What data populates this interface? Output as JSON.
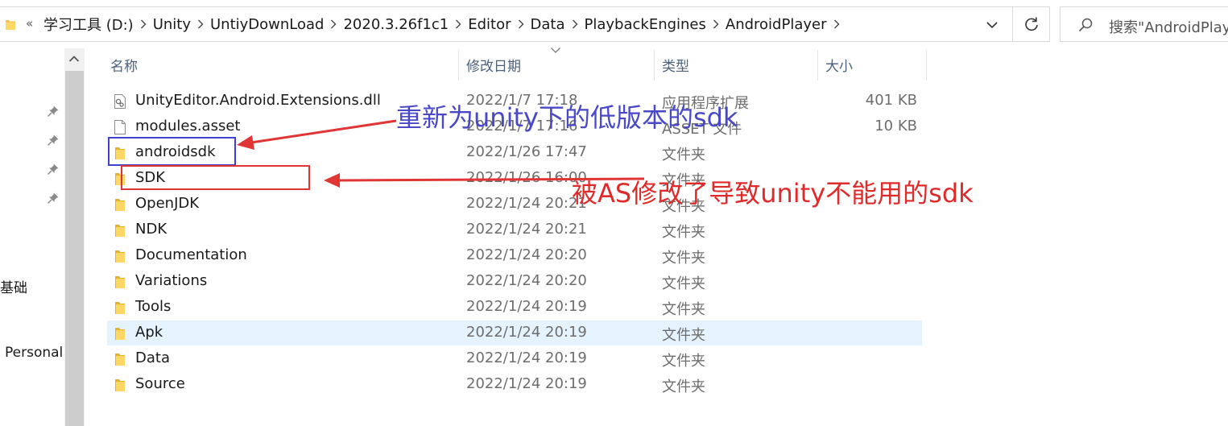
{
  "address_bar": {
    "overflow": "«",
    "path": [
      "学习工具 (D:)",
      "Unity",
      "UntiyDownLoad",
      "2020.3.26f1c1",
      "Editor",
      "Data",
      "PlaybackEngines",
      "AndroidPlayer"
    ]
  },
  "search": {
    "placeholder": "搜索\"AndroidPlayer\""
  },
  "nav_pane": {
    "items": [
      "基础",
      "Personal"
    ]
  },
  "columns": {
    "name": "名称",
    "date": "修改日期",
    "type": "类型",
    "size": "大小"
  },
  "files": [
    {
      "name": "UnityEditor.Android.Extensions.dll",
      "date": "2022/1/7 17:18",
      "type": "应用程序扩展",
      "size": "401 KB",
      "icon": "dll-file-icon"
    },
    {
      "name": "modules.asset",
      "date": "2022/1/7 17:16",
      "type": "ASSET 文件",
      "size": "10 KB",
      "icon": "file-icon"
    },
    {
      "name": "androidsdk",
      "date": "2022/1/26 17:47",
      "type": "文件夹",
      "size": "",
      "icon": "folder-icon"
    },
    {
      "name": "SDK",
      "date": "2022/1/26 16:00",
      "type": "文件夹",
      "size": "",
      "icon": "folder-icon"
    },
    {
      "name": "OpenJDK",
      "date": "2022/1/24 20:21",
      "type": "文件夹",
      "size": "",
      "icon": "folder-icon"
    },
    {
      "name": "NDK",
      "date": "2022/1/24 20:21",
      "type": "文件夹",
      "size": "",
      "icon": "folder-icon"
    },
    {
      "name": "Documentation",
      "date": "2022/1/24 20:20",
      "type": "文件夹",
      "size": "",
      "icon": "folder-icon"
    },
    {
      "name": "Variations",
      "date": "2022/1/24 20:20",
      "type": "文件夹",
      "size": "",
      "icon": "folder-icon"
    },
    {
      "name": "Tools",
      "date": "2022/1/24 20:19",
      "type": "文件夹",
      "size": "",
      "icon": "folder-icon"
    },
    {
      "name": "Apk",
      "date": "2022/1/24 20:19",
      "type": "文件夹",
      "size": "",
      "icon": "folder-icon",
      "selected": true
    },
    {
      "name": "Data",
      "date": "2022/1/24 20:19",
      "type": "文件夹",
      "size": "",
      "icon": "folder-icon"
    },
    {
      "name": "Source",
      "date": "2022/1/24 20:19",
      "type": "文件夹",
      "size": "",
      "icon": "folder-icon"
    }
  ],
  "annotations": {
    "blue_note": "重新为unity下的低版本的sdk",
    "red_note": "被AS修改了导致unity不能用的sdk",
    "blue_color": "#3f3fd0",
    "red_color": "#e03535"
  },
  "colors": {
    "selection": "#e5f3ff",
    "folder": "#f5c242",
    "header_text": "#4c607a"
  }
}
